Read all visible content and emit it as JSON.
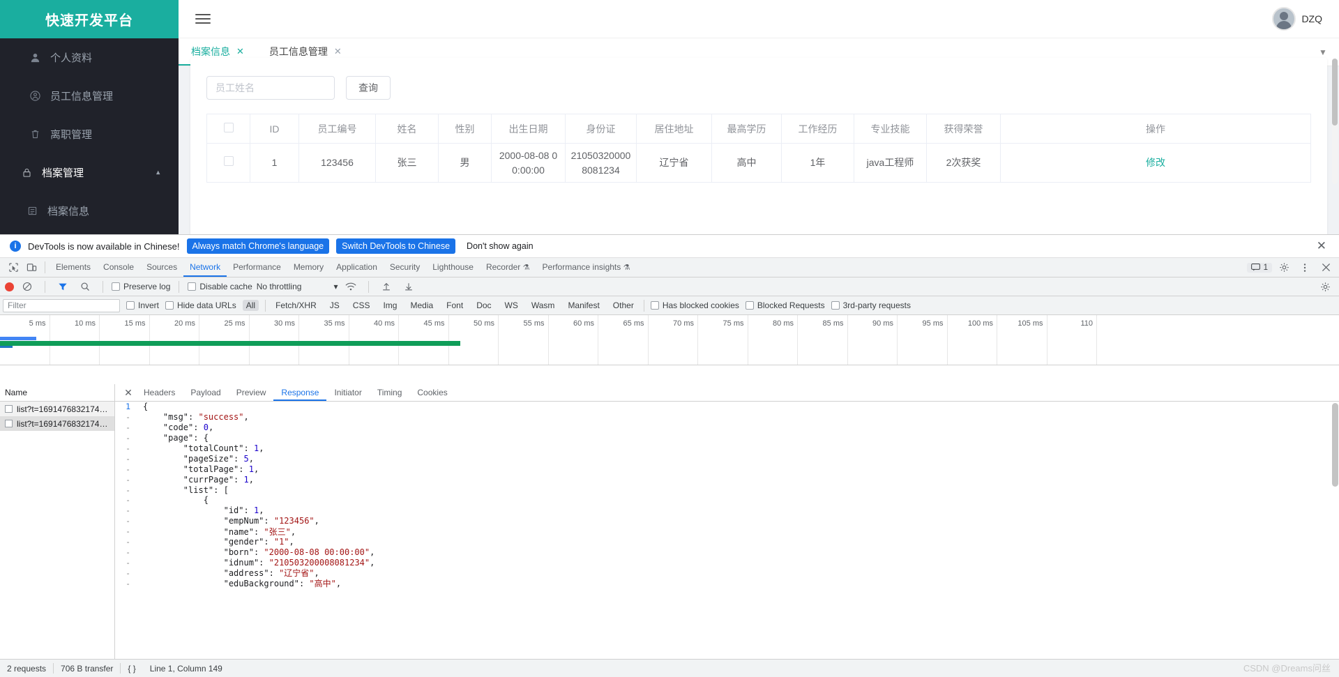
{
  "app": {
    "brand": "快速开发平台",
    "user": "DZQ",
    "sidebar": [
      {
        "label": "个人资料",
        "icon": "user-avatar-icon",
        "type": "item"
      },
      {
        "label": "员工信息管理",
        "icon": "user-circle-icon",
        "type": "item"
      },
      {
        "label": "离职管理",
        "icon": "trash-icon",
        "type": "item"
      },
      {
        "label": "档案管理",
        "icon": "lock-icon",
        "type": "group"
      },
      {
        "label": "档案信息",
        "icon": "doc-icon",
        "type": "sub"
      }
    ],
    "tabs": [
      {
        "label": "档案信息",
        "active": true,
        "close": "✕"
      },
      {
        "label": "员工信息管理",
        "active": false,
        "close": "✕"
      }
    ],
    "search": {
      "placeholder": "员工姓名",
      "value": "",
      "button": "查询"
    },
    "table": {
      "columns": [
        "",
        "ID",
        "员工编号",
        "姓名",
        "性别",
        "出生日期",
        "身份证",
        "居住地址",
        "最高学历",
        "工作经历",
        "专业技能",
        "获得荣誉",
        "操作"
      ],
      "rows": [
        {
          "id": "1",
          "empNum": "123456",
          "name": "张三",
          "gender": "男",
          "born": "2000-08-08 00:00:00",
          "idnum": "210503200008081234",
          "address": "辽宁省",
          "edu": "高中",
          "exp": "1年",
          "skill": "java工程师",
          "honor": "2次获奖",
          "action": "修改"
        }
      ]
    }
  },
  "devtools": {
    "notice": {
      "text": "DevTools is now available in Chinese!",
      "primary": "Always match Chrome's language",
      "secondary": "Switch DevTools to Chinese",
      "dismiss": "Don't show again",
      "close": "✕"
    },
    "panels": [
      "Elements",
      "Console",
      "Sources",
      "Network",
      "Performance",
      "Memory",
      "Application",
      "Security",
      "Lighthouse",
      "Recorder",
      "Performance insights"
    ],
    "active_panel": "Network",
    "experimental_panels": [
      "Recorder",
      "Performance insights"
    ],
    "message_count": "1",
    "toolbar": {
      "preserve_log": "Preserve log",
      "disable_cache": "Disable cache",
      "throttling": "No throttling"
    },
    "filterbar": {
      "placeholder": "Filter",
      "invert": "Invert",
      "hide_data_urls": "Hide data URLs",
      "types": [
        "All",
        "Fetch/XHR",
        "JS",
        "CSS",
        "Img",
        "Media",
        "Font",
        "Doc",
        "WS",
        "Wasm",
        "Manifest",
        "Other"
      ],
      "active_type": "All",
      "has_blocked_cookies": "Has blocked cookies",
      "blocked_requests": "Blocked Requests",
      "third_party": "3rd-party requests"
    },
    "timeline_ticks": [
      "5 ms",
      "10 ms",
      "15 ms",
      "20 ms",
      "25 ms",
      "30 ms",
      "35 ms",
      "40 ms",
      "45 ms",
      "50 ms",
      "55 ms",
      "60 ms",
      "65 ms",
      "70 ms",
      "75 ms",
      "80 ms",
      "85 ms",
      "90 ms",
      "95 ms",
      "100 ms",
      "105 ms",
      "110"
    ],
    "requests": {
      "header": "Name",
      "items": [
        {
          "name": "list?t=1691476832174…",
          "selected": false
        },
        {
          "name": "list?t=1691476832174…",
          "selected": true
        }
      ]
    },
    "detail_tabs": [
      "Headers",
      "Payload",
      "Preview",
      "Response",
      "Initiator",
      "Timing",
      "Cookies"
    ],
    "active_detail_tab": "Response",
    "response_lines": [
      {
        "num": "1",
        "indent": 0,
        "parts": [
          [
            "k",
            "{"
          ]
        ]
      },
      {
        "num": "-",
        "indent": 1,
        "parts": [
          [
            "k",
            "\"msg\": "
          ],
          [
            "s",
            "\"success\""
          ],
          [
            "k",
            ","
          ]
        ]
      },
      {
        "num": "-",
        "indent": 1,
        "parts": [
          [
            "k",
            "\"code\": "
          ],
          [
            "n",
            "0"
          ],
          [
            "k",
            ","
          ]
        ]
      },
      {
        "num": "-",
        "indent": 1,
        "parts": [
          [
            "k",
            "\"page\": {"
          ]
        ]
      },
      {
        "num": "-",
        "indent": 2,
        "parts": [
          [
            "k",
            "\"totalCount\": "
          ],
          [
            "n",
            "1"
          ],
          [
            "k",
            ","
          ]
        ]
      },
      {
        "num": "-",
        "indent": 2,
        "parts": [
          [
            "k",
            "\"pageSize\": "
          ],
          [
            "n",
            "5"
          ],
          [
            "k",
            ","
          ]
        ]
      },
      {
        "num": "-",
        "indent": 2,
        "parts": [
          [
            "k",
            "\"totalPage\": "
          ],
          [
            "n",
            "1"
          ],
          [
            "k",
            ","
          ]
        ]
      },
      {
        "num": "-",
        "indent": 2,
        "parts": [
          [
            "k",
            "\"currPage\": "
          ],
          [
            "n",
            "1"
          ],
          [
            "k",
            ","
          ]
        ]
      },
      {
        "num": "-",
        "indent": 2,
        "parts": [
          [
            "k",
            "\"list\": ["
          ]
        ]
      },
      {
        "num": "-",
        "indent": 3,
        "parts": [
          [
            "k",
            "{"
          ]
        ]
      },
      {
        "num": "-",
        "indent": 4,
        "parts": [
          [
            "k",
            "\"id\": "
          ],
          [
            "n",
            "1"
          ],
          [
            "k",
            ","
          ]
        ]
      },
      {
        "num": "-",
        "indent": 4,
        "parts": [
          [
            "k",
            "\"empNum\": "
          ],
          [
            "s",
            "\"123456\""
          ],
          [
            "k",
            ","
          ]
        ]
      },
      {
        "num": "-",
        "indent": 4,
        "parts": [
          [
            "k",
            "\"name\": "
          ],
          [
            "s",
            "\"张三\""
          ],
          [
            "k",
            ","
          ]
        ]
      },
      {
        "num": "-",
        "indent": 4,
        "parts": [
          [
            "k",
            "\"gender\": "
          ],
          [
            "s",
            "\"1\""
          ],
          [
            "k",
            ","
          ]
        ]
      },
      {
        "num": "-",
        "indent": 4,
        "parts": [
          [
            "k",
            "\"born\": "
          ],
          [
            "s",
            "\"2000-08-08 00:00:00\""
          ],
          [
            "k",
            ","
          ]
        ]
      },
      {
        "num": "-",
        "indent": 4,
        "parts": [
          [
            "k",
            "\"idnum\": "
          ],
          [
            "s",
            "\"210503200008081234\""
          ],
          [
            "k",
            ","
          ]
        ]
      },
      {
        "num": "-",
        "indent": 4,
        "parts": [
          [
            "k",
            "\"address\": "
          ],
          [
            "s",
            "\"辽宁省\""
          ],
          [
            "k",
            ","
          ]
        ]
      },
      {
        "num": "-",
        "indent": 4,
        "parts": [
          [
            "k",
            "\"eduBackground\": "
          ],
          [
            "s",
            "\"高中\""
          ],
          [
            "k",
            ","
          ]
        ]
      }
    ],
    "status": {
      "requests": "2 requests",
      "transfer": "706 B transfer",
      "cursor": "Line 1, Column 149"
    }
  },
  "watermark": "CSDN @Dreams问丝",
  "colors": {
    "brand": "#1aae9f",
    "devtools_blue": "#1a73e8",
    "sidebar": "#20222a"
  }
}
